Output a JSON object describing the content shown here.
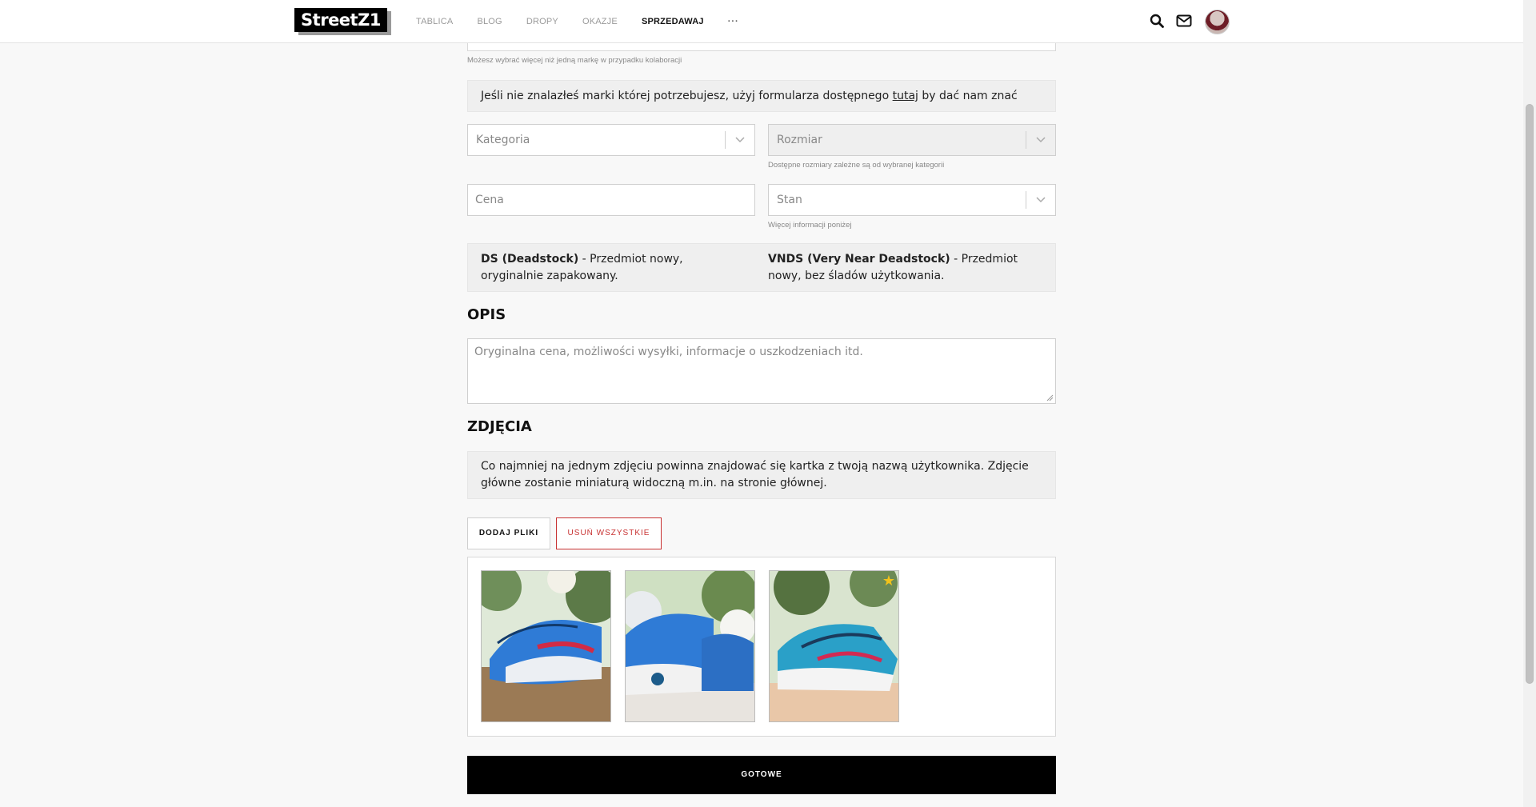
{
  "header": {
    "logo": "StreetZ1",
    "nav": [
      "TABLICA",
      "BLOG",
      "DROPY",
      "OKAZJE",
      "SPRZEDAWAJ",
      "···"
    ],
    "active_nav": "SPRZEDAWAJ",
    "icons": [
      "search-icon",
      "mail-icon",
      "avatar"
    ]
  },
  "brand": {
    "hint": "Możesz wybrać więcej niż jedną markę w przypadku kolaboracji",
    "missing_text_before": "Jeśli nie znalazłeś marki której potrzebujesz, użyj formularza dostępnego ",
    "missing_link": "tutaj",
    "missing_text_after": " by dać nam znać"
  },
  "fields": {
    "category_placeholder": "Kategoria",
    "size_placeholder": "Rozmiar",
    "size_hint": "Dostępne rozmiary zależne są od wybranej kategorii",
    "price_placeholder": "Cena",
    "condition_placeholder": "Stan",
    "condition_hint": "Więcej informacji poniżej"
  },
  "conditions": {
    "ds_term": "DS (Deadstock)",
    "ds_desc": " - Przedmiot nowy, oryginalnie zapakowany.",
    "vnds_term": "VNDS (Very Near Deadstock)",
    "vnds_desc": " - Przedmiot nowy, bez śladów użytkowania."
  },
  "description": {
    "title": "OPIS",
    "placeholder": "Oryginalna cena, możliwości wysyłki, informacje o uszkodzeniach itd."
  },
  "photos": {
    "title": "ZDJĘCIA",
    "info": "Co najmniej na jednym zdjęciu powinna znajdować się kartka z twoją nazwą użytkownika. Zdjęcie główne zostanie miniaturą widoczną m.in. na stronie głównej.",
    "add_button": "DODAJ PLIKI",
    "remove_button": "USUŃ WSZYSTKIE",
    "items": [
      "sneaker-photo-1",
      "sneaker-photo-2",
      "sneaker-photo-3"
    ],
    "main_photo_index": 3
  },
  "submit_button": "GOTOWE",
  "colors": {
    "accent_red": "#c83232",
    "dark": "#000000",
    "box_gray": "#efefef",
    "star": "#f2c21b"
  }
}
